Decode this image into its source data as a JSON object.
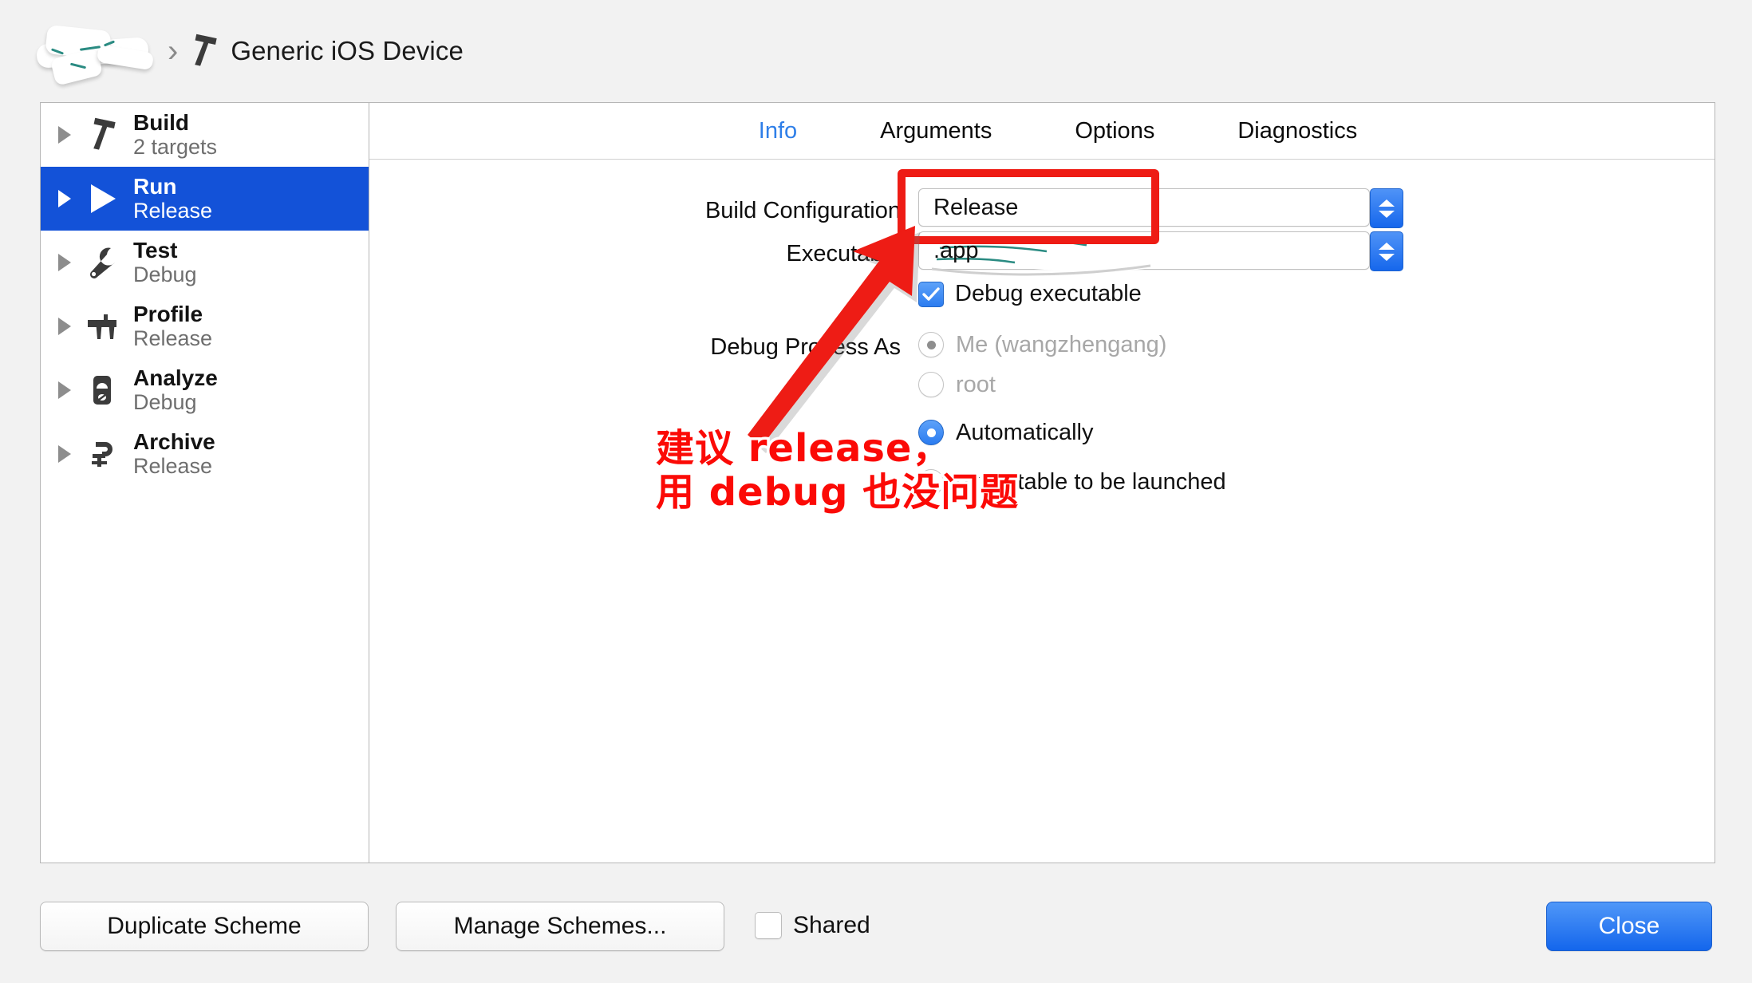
{
  "titlebar": {
    "scheme_name_redacted": "",
    "separator": "›",
    "hammer_icon": "hammer-icon",
    "destination": "Generic iOS Device"
  },
  "sidebar": {
    "items": [
      {
        "title": "Build",
        "subtitle": "2 targets",
        "icon": "hammer-icon",
        "selected": false
      },
      {
        "title": "Run",
        "subtitle": "Release",
        "icon": "play-icon",
        "selected": true
      },
      {
        "title": "Test",
        "subtitle": "Debug",
        "icon": "wrench-icon",
        "selected": false
      },
      {
        "title": "Profile",
        "subtitle": "Release",
        "icon": "caliper-icon",
        "selected": false
      },
      {
        "title": "Analyze",
        "subtitle": "Debug",
        "icon": "stethoscope-icon",
        "selected": false
      },
      {
        "title": "Archive",
        "subtitle": "Release",
        "icon": "clamp-icon",
        "selected": false
      }
    ]
  },
  "tabs": [
    {
      "label": "Info",
      "active": true
    },
    {
      "label": "Arguments",
      "active": false
    },
    {
      "label": "Options",
      "active": false
    },
    {
      "label": "Diagnostics",
      "active": false
    }
  ],
  "form": {
    "build_configuration": {
      "label": "Build Configuration",
      "value": "Release"
    },
    "executable": {
      "label": "Executable",
      "value": ".app",
      "debug_checkbox_label": "Debug executable",
      "debug_checkbox_checked": true
    },
    "debug_process_as": {
      "label": "Debug Process As",
      "options": [
        {
          "label": "Me (wangzhengang)",
          "selected": true
        },
        {
          "label": "root",
          "selected": false
        }
      ]
    },
    "launch": {
      "options": [
        {
          "label": "Automatically",
          "selected": true
        },
        {
          "label": "executable to be launched",
          "selected": false
        }
      ]
    }
  },
  "annotations": {
    "chinese_note_line1": "建议 release，",
    "chinese_note_line2": "用 debug 也没问题",
    "highlight_color": "#ee1c15",
    "arrow_color": "#ee1c15"
  },
  "bottombar": {
    "duplicate_scheme": "Duplicate Scheme",
    "manage_schemes": "Manage Schemes...",
    "shared_label": "Shared",
    "shared_checked": false,
    "close": "Close"
  },
  "colors": {
    "selection_blue": "#1352d8",
    "accent_blue": "#2f7fe8",
    "control_blue": "#1667ec"
  }
}
